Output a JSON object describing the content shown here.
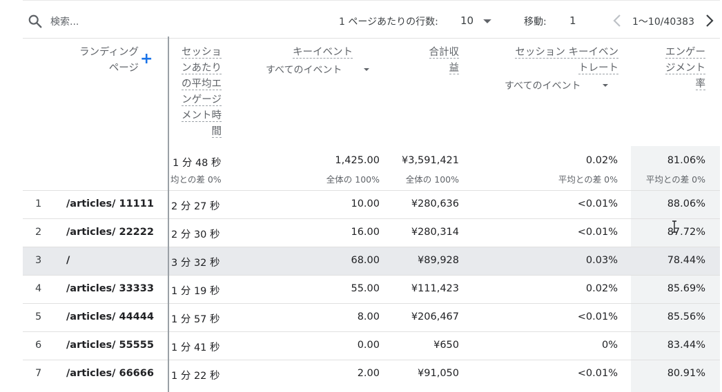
{
  "toolbar": {
    "search_placeholder": "検索...",
    "rows_per_page_label": "1 ページあたりの行数:",
    "rows_per_page_value": "10",
    "move_label": "移動:",
    "move_value": "1",
    "range": "1〜10/40383",
    "icons": [
      "search-icon",
      "chevron-down-icon",
      "chevron-left-icon",
      "chevron-right-icon"
    ]
  },
  "headers": {
    "landing_page": [
      "ランディング",
      "ページ"
    ],
    "add_button": "+",
    "avg_engagement": [
      "セッショ",
      "ンあたり",
      "の平均エ",
      "ンゲージ",
      "メント時",
      "間"
    ],
    "key_event": "キーイベント",
    "key_event_filter": "すべてのイベント",
    "revenue": [
      "合計収",
      "益"
    ],
    "ke_rate": [
      "セッション キーイベン",
      "トレート"
    ],
    "ke_rate_filter": "すべてのイベント",
    "engagement_rate": [
      "エンゲー",
      "ジメント",
      "率"
    ]
  },
  "totals": {
    "avg_engagement": "1 分 48 秒",
    "avg_engagement_sub": "均との差 0%",
    "key_events": "1,425.00",
    "key_events_sub": "全体の 100%",
    "revenue": "¥3,591,421",
    "revenue_sub": "全体の 100%",
    "ke_rate": "0.02%",
    "ke_rate_sub": "平均との差 0%",
    "engagement_rate": "81.06%",
    "engagement_rate_sub": "平均との差 0%"
  },
  "rows": [
    {
      "num": "1",
      "page": "/articles/ 11111",
      "duration": "2 分 27 秒",
      "key_events": "10.00",
      "revenue": "¥280,636",
      "rate": "<0.01%",
      "engagement": "88.06%"
    },
    {
      "num": "2",
      "page": "/articles/ 22222",
      "duration": "2 分 30 秒",
      "key_events": "16.00",
      "revenue": "¥280,314",
      "rate": "<0.01%",
      "engagement": "87.72%"
    },
    {
      "num": "3",
      "page": "/",
      "duration": "3 分 32 秒",
      "key_events": "68.00",
      "revenue": "¥89,928",
      "rate": "0.03%",
      "engagement": "78.44%"
    },
    {
      "num": "4",
      "page": "/articles/ 33333",
      "duration": "1 分 19 秒",
      "key_events": "55.00",
      "revenue": "¥111,423",
      "rate": "0.02%",
      "engagement": "85.69%"
    },
    {
      "num": "5",
      "page": "/articles/ 44444",
      "duration": "1 分 57 秒",
      "key_events": "8.00",
      "revenue": "¥206,467",
      "rate": "<0.01%",
      "engagement": "85.56%"
    },
    {
      "num": "6",
      "page": "/articles/ 55555",
      "duration": "1 分 41 秒",
      "key_events": "0.00",
      "revenue": "¥650",
      "rate": "0%",
      "engagement": "83.44%"
    },
    {
      "num": "7",
      "page": "/articles/ 66666",
      "duration": "1 分 22 秒",
      "key_events": "2.00",
      "revenue": "¥91,050",
      "rate": "<0.01%",
      "engagement": "80.91%"
    }
  ],
  "colors": {
    "accent": "#1a73e8",
    "highlight_column": "#f1f3f4",
    "active_row": "#e8eaed"
  }
}
